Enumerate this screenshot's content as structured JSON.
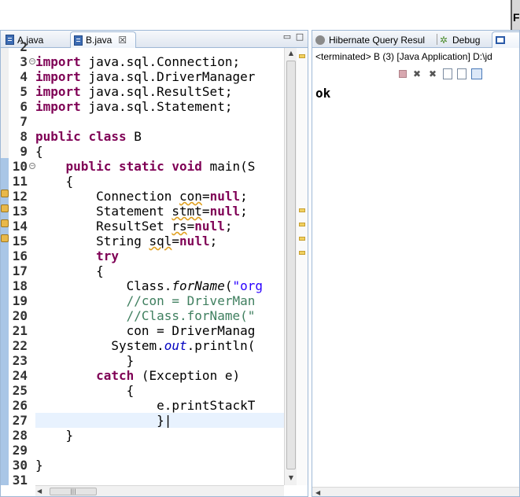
{
  "editor": {
    "tabs": [
      {
        "label": "A.java",
        "active": false
      },
      {
        "label": "B.java",
        "active": true
      }
    ],
    "close_glyph": "☒",
    "lines": [
      {
        "n": "2",
        "html": ""
      },
      {
        "n": "3",
        "html": "<span class=\"kw\">import</span> java.sql.Connection;"
      },
      {
        "n": "4",
        "html": "<span class=\"kw\">import</span> java.sql.DriverManager"
      },
      {
        "n": "5",
        "html": "<span class=\"kw\">import</span> java.sql.ResultSet;"
      },
      {
        "n": "6",
        "html": "<span class=\"kw\">import</span> java.sql.Statement;"
      },
      {
        "n": "7",
        "html": ""
      },
      {
        "n": "8",
        "html": "<span class=\"kw\">public</span> <span class=\"kw\">class</span> B"
      },
      {
        "n": "9",
        "html": "{"
      },
      {
        "n": "10",
        "html": "    <span class=\"kw\">public</span> <span class=\"kw\">static</span> <span class=\"kw\">void</span> main(S"
      },
      {
        "n": "11",
        "html": "    {"
      },
      {
        "n": "12",
        "html": "        Connection <span class=\"squig\">con</span>=<span class=\"kw\">null</span>;"
      },
      {
        "n": "13",
        "html": "        Statement <span class=\"squig\">stmt</span>=<span class=\"kw\">null</span>;"
      },
      {
        "n": "14",
        "html": "        ResultSet <span class=\"squig\">rs</span>=<span class=\"kw\">null</span>;"
      },
      {
        "n": "15",
        "html": "        String <span class=\"squig\">sql</span>=<span class=\"kw\">null</span>;"
      },
      {
        "n": "16",
        "html": "        <span class=\"kw\">try</span>"
      },
      {
        "n": "17",
        "html": "        {"
      },
      {
        "n": "18",
        "html": "            Class.<span class=\"itl\">forName</span>(<span class=\"str\">\"org</span>"
      },
      {
        "n": "19",
        "html": "            <span class=\"cmt\">//con = DriverMan</span>"
      },
      {
        "n": "20",
        "html": "            <span class=\"cmt\">//Class.forName(\"</span>"
      },
      {
        "n": "21",
        "html": "            con = DriverManag"
      },
      {
        "n": "22",
        "html": "          System.<span class=\"fld\">out</span>.println("
      },
      {
        "n": "23",
        "html": "            }"
      },
      {
        "n": "24",
        "html": "        <span class=\"kw\">catch</span> (Exception e)"
      },
      {
        "n": "25",
        "html": "            {"
      },
      {
        "n": "26",
        "html": "                e.printStackT"
      },
      {
        "n": "27",
        "html": "                }|"
      },
      {
        "n": "28",
        "html": "    }"
      },
      {
        "n": "29",
        "html": ""
      },
      {
        "n": "30",
        "html": "}"
      },
      {
        "n": "31",
        "html": ""
      }
    ]
  },
  "console": {
    "tabs": [
      {
        "label": "Hibernate Query Resul"
      },
      {
        "label": "Debug"
      },
      {
        "label": ""
      }
    ],
    "status": "<terminated> B (3) [Java Application] D:\\jd",
    "output": "ok"
  },
  "window": {
    "edge_letter": "F"
  }
}
